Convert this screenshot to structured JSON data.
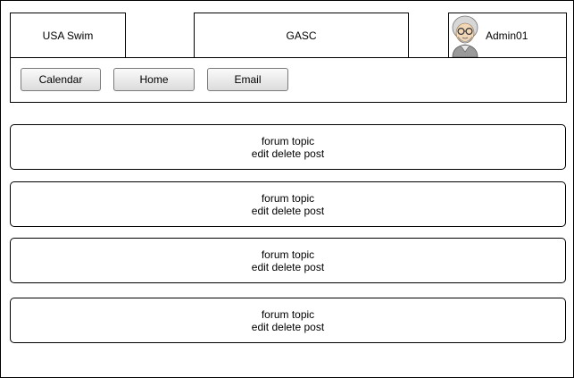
{
  "header": {
    "left_label": "USA Swim",
    "center_label": "GASC",
    "user_name": "Admin01"
  },
  "nav": {
    "buttons": [
      {
        "label": "Calendar"
      },
      {
        "label": "Home"
      },
      {
        "label": "Email"
      }
    ]
  },
  "topics": [
    {
      "title": "forum topic",
      "actions": "edit delete post"
    },
    {
      "title": "forum topic",
      "actions": "edit delete post"
    },
    {
      "title": "forum topic",
      "actions": "edit delete post"
    },
    {
      "title": "forum topic",
      "actions": "edit delete post"
    }
  ],
  "icons": {
    "avatar": "user-avatar-icon"
  }
}
